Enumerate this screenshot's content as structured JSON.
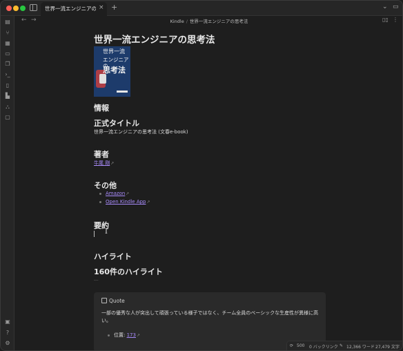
{
  "tab": {
    "title": "世界一流エンジニアの思...",
    "close": "×",
    "new": "+"
  },
  "nav": {
    "back": "←",
    "forward": "→"
  },
  "breadcrumb": {
    "folder": "Kindle",
    "separator": "/",
    "file": "世界一流エンジニアの思考法"
  },
  "ribbon_icons": [
    "files-icon",
    "graph-icon",
    "canvas-icon",
    "calendar-icon",
    "copy-icon",
    "terminal-icon",
    "book-icon",
    "chart-icon",
    "sitemap-icon",
    "comment-icon"
  ],
  "ribbon_bottom_icons": [
    "vault-icon",
    "help-icon",
    "settings-icon"
  ],
  "note": {
    "title": "世界一流エンジニアの思考法",
    "cover": {
      "line1": "世界一流",
      "line2": "エンジニアの",
      "line3": "思考法"
    },
    "info_heading": "情報",
    "official_title_heading": "正式タイトル",
    "official_title": "世界一流エンジニアの思考法 (文春e-book)",
    "author_heading": "著者",
    "author": "牛尾 剛",
    "other_heading": "その他",
    "links": [
      "Amazon",
      "Open Kindle App"
    ],
    "summary_heading": "要約",
    "highlight_heading": "ハイライト",
    "highlight_count": "160件のハイライト",
    "hr": "---",
    "quote": {
      "title": "Quote",
      "body": "一部の優秀な人が突出して頑張っている様子ではなく、チーム全員のベーシックな生産性が異様に高い。",
      "location_label": "位置:",
      "location": "173"
    }
  },
  "status": {
    "count": "500",
    "backlinks": "0 バックリンク",
    "words": "12,366 ワード",
    "chars": "27,479 文字"
  },
  "colors": {
    "accent": "#a88bfa",
    "background": "#1e1e1e",
    "callout": "#2a2a2a"
  }
}
